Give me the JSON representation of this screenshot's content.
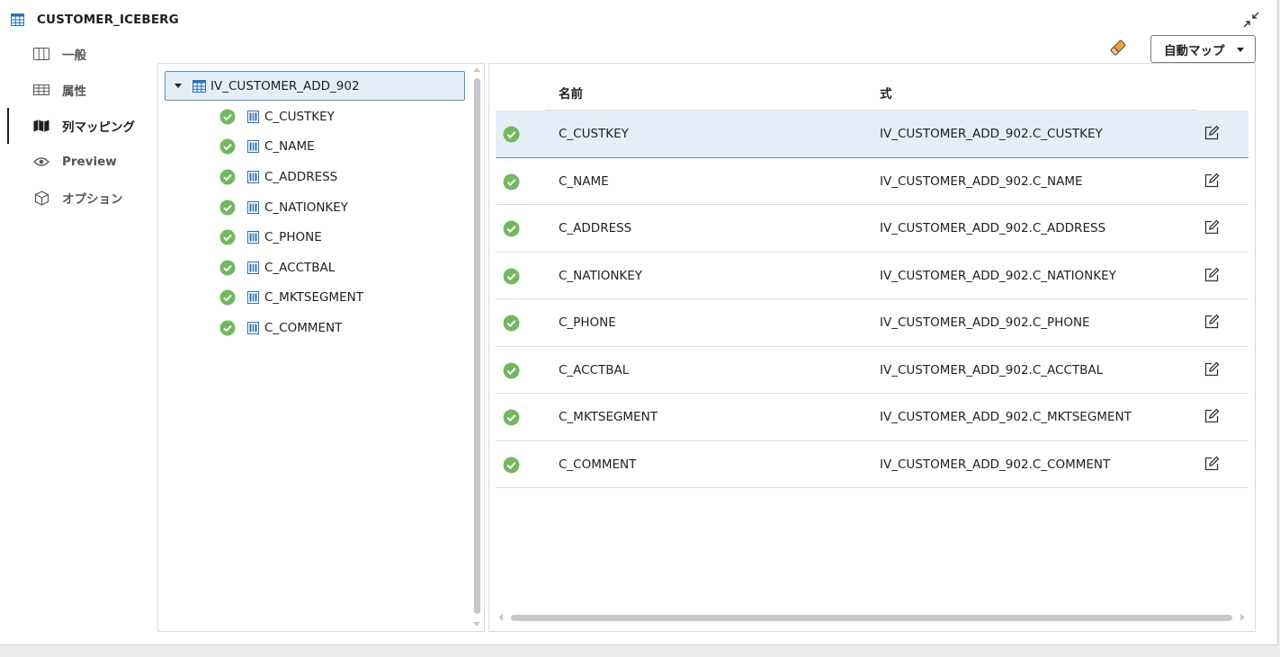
{
  "window": {
    "title": "CUSTOMER_ICEBERG",
    "title_icon": "table-icon",
    "collapse_icon": "collapse-icon"
  },
  "nav": {
    "items": [
      {
        "label": "一般",
        "icon": "columns-icon",
        "active": false
      },
      {
        "label": "属性",
        "icon": "table-icon",
        "active": false
      },
      {
        "label": "列マッピング",
        "icon": "map-icon",
        "active": true
      },
      {
        "label": "Preview",
        "icon": "eye-icon",
        "active": false
      },
      {
        "label": "オプション",
        "icon": "cube-icon",
        "active": false
      }
    ]
  },
  "tree": {
    "root": {
      "label": "IV_CUSTOMER_ADD_902",
      "expanded": true
    },
    "children": [
      {
        "label": "C_CUSTKEY",
        "status": "mapped"
      },
      {
        "label": "C_NAME",
        "status": "mapped"
      },
      {
        "label": "C_ADDRESS",
        "status": "mapped"
      },
      {
        "label": "C_NATIONKEY",
        "status": "mapped"
      },
      {
        "label": "C_PHONE",
        "status": "mapped"
      },
      {
        "label": "C_ACCTBAL",
        "status": "mapped"
      },
      {
        "label": "C_MKTSEGMENT",
        "status": "mapped"
      },
      {
        "label": "C_COMMENT",
        "status": "mapped"
      }
    ]
  },
  "toolbar": {
    "clear_icon": "eraser-icon",
    "automap_label": "自動マップ"
  },
  "mapping": {
    "headers": {
      "name": "名前",
      "expression": "式"
    },
    "rows": [
      {
        "name": "C_CUSTKEY",
        "expression": "IV_CUSTOMER_ADD_902.C_CUSTKEY",
        "selected": true
      },
      {
        "name": "C_NAME",
        "expression": "IV_CUSTOMER_ADD_902.C_NAME",
        "selected": false
      },
      {
        "name": "C_ADDRESS",
        "expression": "IV_CUSTOMER_ADD_902.C_ADDRESS",
        "selected": false
      },
      {
        "name": "C_NATIONKEY",
        "expression": "IV_CUSTOMER_ADD_902.C_NATIONKEY",
        "selected": false
      },
      {
        "name": "C_PHONE",
        "expression": "IV_CUSTOMER_ADD_902.C_PHONE",
        "selected": false
      },
      {
        "name": "C_ACCTBAL",
        "expression": "IV_CUSTOMER_ADD_902.C_ACCTBAL",
        "selected": false
      },
      {
        "name": "C_MKTSEGMENT",
        "expression": "IV_CUSTOMER_ADD_902.C_MKTSEGMENT",
        "selected": false
      },
      {
        "name": "C_COMMENT",
        "expression": "IV_CUSTOMER_ADD_902.C_COMMENT",
        "selected": false
      }
    ]
  },
  "colors": {
    "check_green": "#72b85f",
    "selection_bg": "#e5eef6",
    "selection_border": "#5f8fb8",
    "table_icon_blue": "#2f6fb3"
  }
}
